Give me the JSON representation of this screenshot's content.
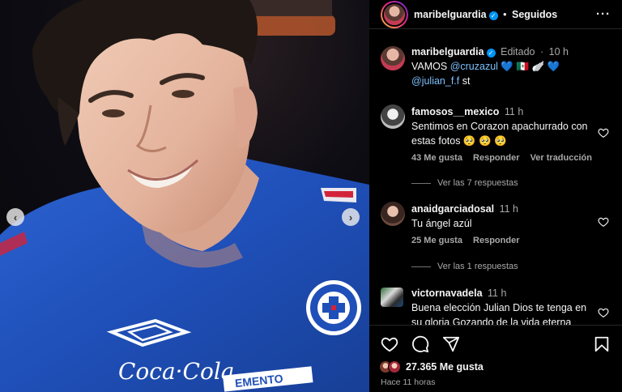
{
  "post": {
    "author": "maribelguardia",
    "follow_status": "Seguidos",
    "separator": "•",
    "caption": {
      "author": "maribelguardia",
      "edited_label": "Editado",
      "separator": "·",
      "time": "10 h",
      "text_before": "VAMOS ",
      "mention1": "@cruzazul",
      "emojis": " 💙 🇲🇽 🪽 💙",
      "mention2": "@julian_f.f",
      "text_after": " st"
    }
  },
  "comments": [
    {
      "user": "famosos__mexico",
      "time": "11 h",
      "text": "Sentimos en Corazon apachurrado con estas fotos 🥺 🥺 🥺",
      "likes": "43 Me gusta",
      "reply": "Responder",
      "translate": "Ver traducción",
      "view_replies": "Ver las 7 respuestas"
    },
    {
      "user": "anaidgarciadosal",
      "time": "11 h",
      "text": "Tu ángel azúl",
      "likes": "25 Me gusta",
      "reply": "Responder",
      "view_replies": "Ver las 1 respuestas"
    },
    {
      "user": "victornavadela",
      "time": "11 h",
      "text": "Buena elección Julian Dios te tenga en su gloria Gozando de la vida eterna"
    }
  ],
  "footer": {
    "likes": "27.365 Me gusta",
    "time_ago": "Hace 11 horas"
  },
  "media": {
    "jersey_sponsor": "Coca·Cola",
    "jersey_text": "EMENTO"
  },
  "icons": {
    "prev": "chevron-left-icon",
    "next": "chevron-right-icon",
    "more": "more-options-icon",
    "like": "heart-icon",
    "comment": "comment-icon",
    "share": "share-icon",
    "save": "bookmark-icon"
  },
  "colors": {
    "background": "#000000",
    "jersey_blue": "#1f4fb8",
    "verified": "#0095f6",
    "muted_text": "#a8a8a8",
    "mention": "#7dc0ff"
  }
}
